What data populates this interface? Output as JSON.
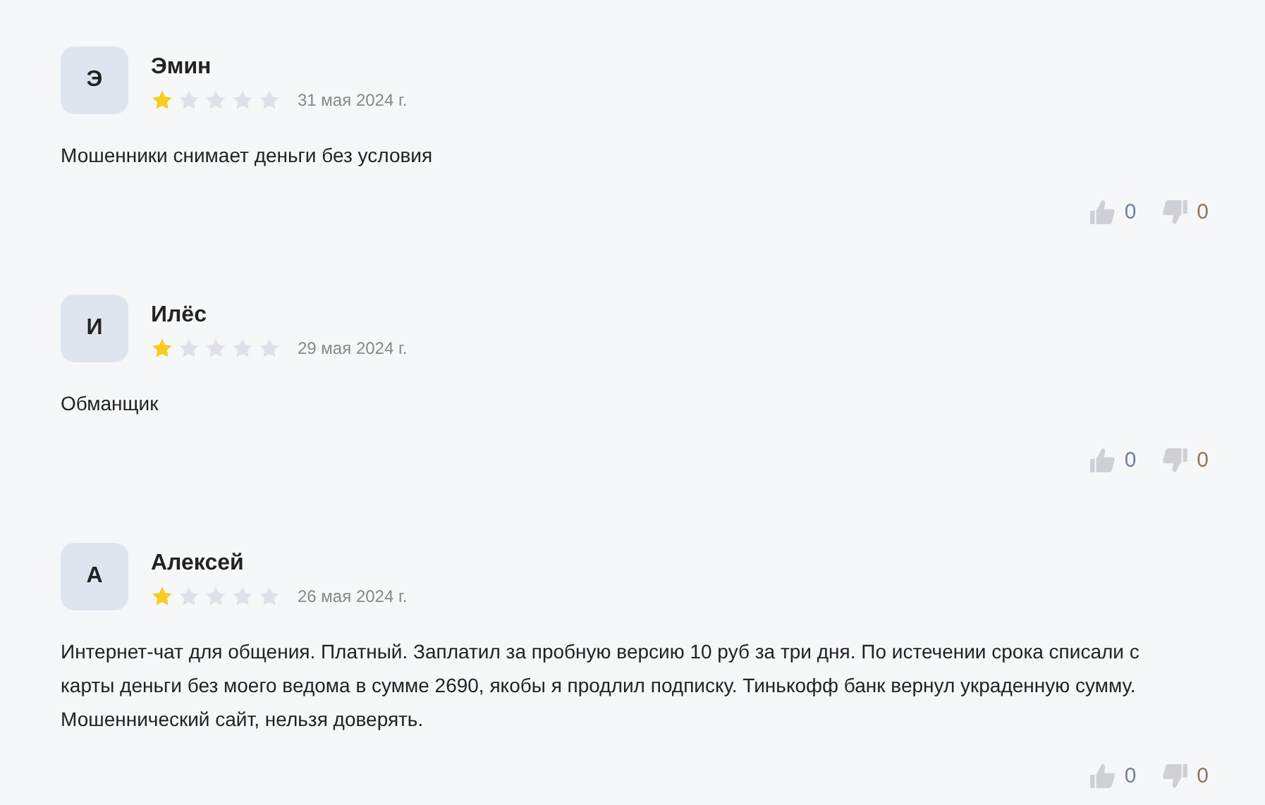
{
  "reviews": [
    {
      "initial": "Э",
      "name": "Эмин",
      "stars": 1,
      "date": "31 мая 2024 г.",
      "text": "Мошенники снимает деньги без условия",
      "likes": "0",
      "dislikes": "0"
    },
    {
      "initial": "И",
      "name": "Илёс",
      "stars": 1,
      "date": "29 мая 2024 г.",
      "text": "Обманщик",
      "likes": "0",
      "dislikes": "0"
    },
    {
      "initial": "А",
      "name": "Алексей",
      "stars": 1,
      "date": "26 мая 2024 г.",
      "text": "Интернет-чат для общения. Платный. Заплатил за пробную версию 10 руб за три дня. По истечении срока списали с карты деньги без моего ведома в сумме 2690, якобы я продлил подписку. Тинькофф банк вернул украденную сумму. Мошеннический сайт, нельзя доверять.",
      "likes": "0",
      "dislikes": "0"
    }
  ]
}
